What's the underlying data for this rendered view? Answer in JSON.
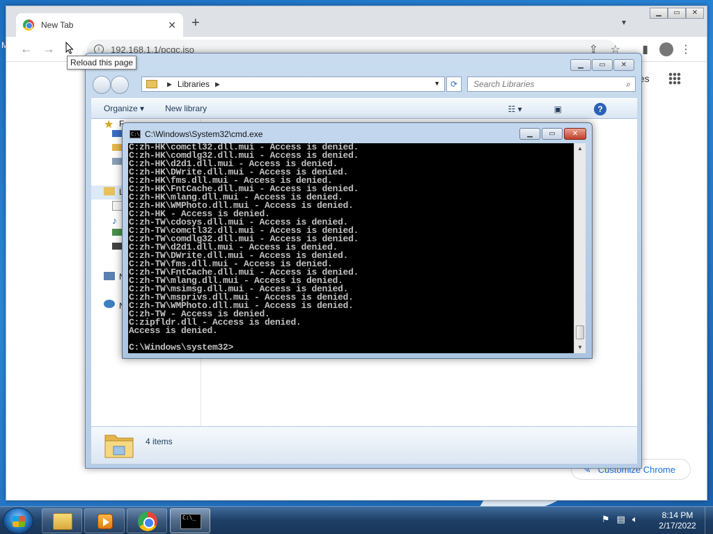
{
  "chrome": {
    "tab_title": "New Tab",
    "tab_close": "✕",
    "new_tab": "+",
    "address": "192.168.1.1/pcgc.iso",
    "tooltip": "Reload this page",
    "pages_link": "ges",
    "customize_label": "Customize Chrome"
  },
  "explorer": {
    "breadcrumb": "Libraries",
    "search_placeholder": "Search Libraries",
    "organize": "Organize ▾",
    "new_library": "New library",
    "item_count": "4 items",
    "nav_letters": [
      "F",
      "L",
      "N",
      "N"
    ]
  },
  "cmd": {
    "title": "C:\\Windows\\System32\\cmd.exe",
    "lines": [
      "C:zh-HK\\comctl32.dll.mui - Access is denied.",
      "C:zh-HK\\comdlg32.dll.mui - Access is denied.",
      "C:zh-HK\\d2d1.dll.mui - Access is denied.",
      "C:zh-HK\\DWrite.dll.mui - Access is denied.",
      "C:zh-HK\\fms.dll.mui - Access is denied.",
      "C:zh-HK\\FntCache.dll.mui - Access is denied.",
      "C:zh-HK\\mlang.dll.mui - Access is denied.",
      "C:zh-HK\\WMPhoto.dll.mui - Access is denied.",
      "C:zh-HK - Access is denied.",
      "C:zh-TW\\cdosys.dll.mui - Access is denied.",
      "C:zh-TW\\comctl32.dll.mui - Access is denied.",
      "C:zh-TW\\comdlg32.dll.mui - Access is denied.",
      "C:zh-TW\\d2d1.dll.mui - Access is denied.",
      "C:zh-TW\\DWrite.dll.mui - Access is denied.",
      "C:zh-TW\\fms.dll.mui - Access is denied.",
      "C:zh-TW\\FntCache.dll.mui - Access is denied.",
      "C:zh-TW\\mlang.dll.mui - Access is denied.",
      "C:zh-TW\\msimsg.dll.mui - Access is denied.",
      "C:zh-TW\\msprivs.dll.mui - Access is denied.",
      "C:zh-TW\\WMPhoto.dll.mui - Access is denied.",
      "C:zh-TW - Access is denied.",
      "C:zipfldr.dll - Access is denied.",
      "Access is denied."
    ],
    "prompt": "C:\\Windows\\system32>"
  },
  "taskbar": {
    "time": "8:14 PM",
    "date": "2/17/2022"
  },
  "desktop": {
    "edge_letter": "M"
  }
}
